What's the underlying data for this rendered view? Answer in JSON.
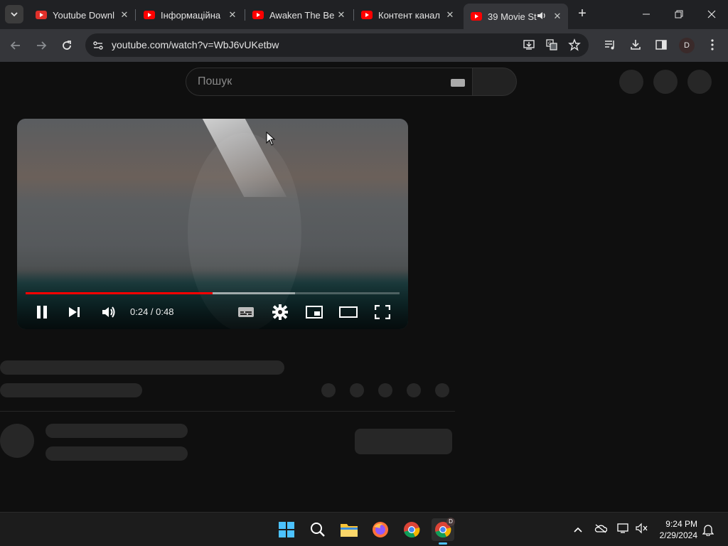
{
  "browser": {
    "tabs": [
      {
        "title": "Youtube Downl",
        "active": false
      },
      {
        "title": "Інформаційна",
        "active": false
      },
      {
        "title": "Awaken The Be",
        "active": false
      },
      {
        "title": "Контент канал",
        "active": false
      },
      {
        "title": "39 Movie St",
        "active": true,
        "audio": true
      }
    ],
    "url": "youtube.com/watch?v=WbJ6vUKetbw",
    "profile_initial": "D"
  },
  "youtube": {
    "search_placeholder": "Пошук"
  },
  "player": {
    "time_display": "0:24 / 0:48",
    "progress_fraction": 0.5,
    "buffered_fraction": 0.72,
    "state": "playing"
  },
  "taskbar": {
    "time": "9:24 PM",
    "date": "2/29/2024",
    "chrome_badge": "D"
  }
}
